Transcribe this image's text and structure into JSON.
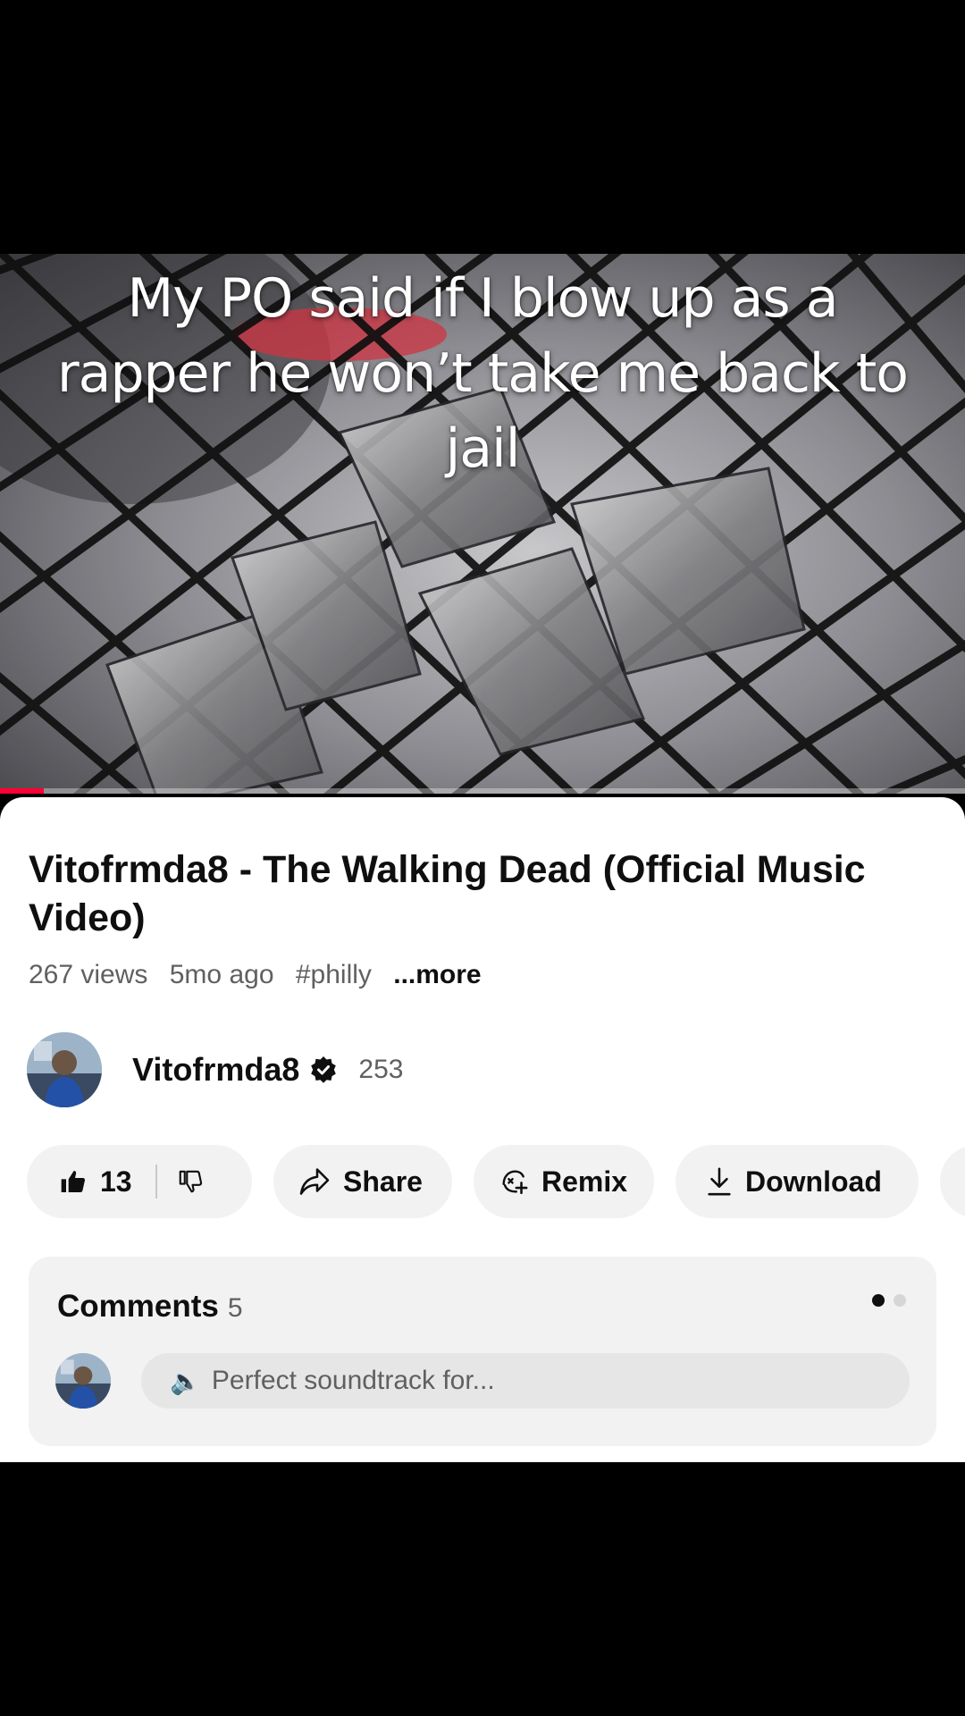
{
  "video": {
    "overlay_caption": "My PO said if I blow up as a rapper he won’t take me back to jail",
    "watched_fraction": 0.045,
    "progress_color": "#ff0033"
  },
  "details": {
    "title": "Vitofrmda8 - The Walking Dead (Official Music Video)",
    "views": "267 views",
    "age": "5mo ago",
    "hashtag": "#philly",
    "more_label": "...more"
  },
  "channel": {
    "name": "Vitofrmda8",
    "subscribers": "253",
    "verified_icon": "verified-badge-icon"
  },
  "actions": {
    "like_count": "13",
    "share_label": "Share",
    "remix_label": "Remix",
    "download_label": "Download"
  },
  "comments": {
    "heading": "Comments",
    "count": "5",
    "preview_emoji": "🔈",
    "preview_text": "Perfect soundtrack for..."
  }
}
